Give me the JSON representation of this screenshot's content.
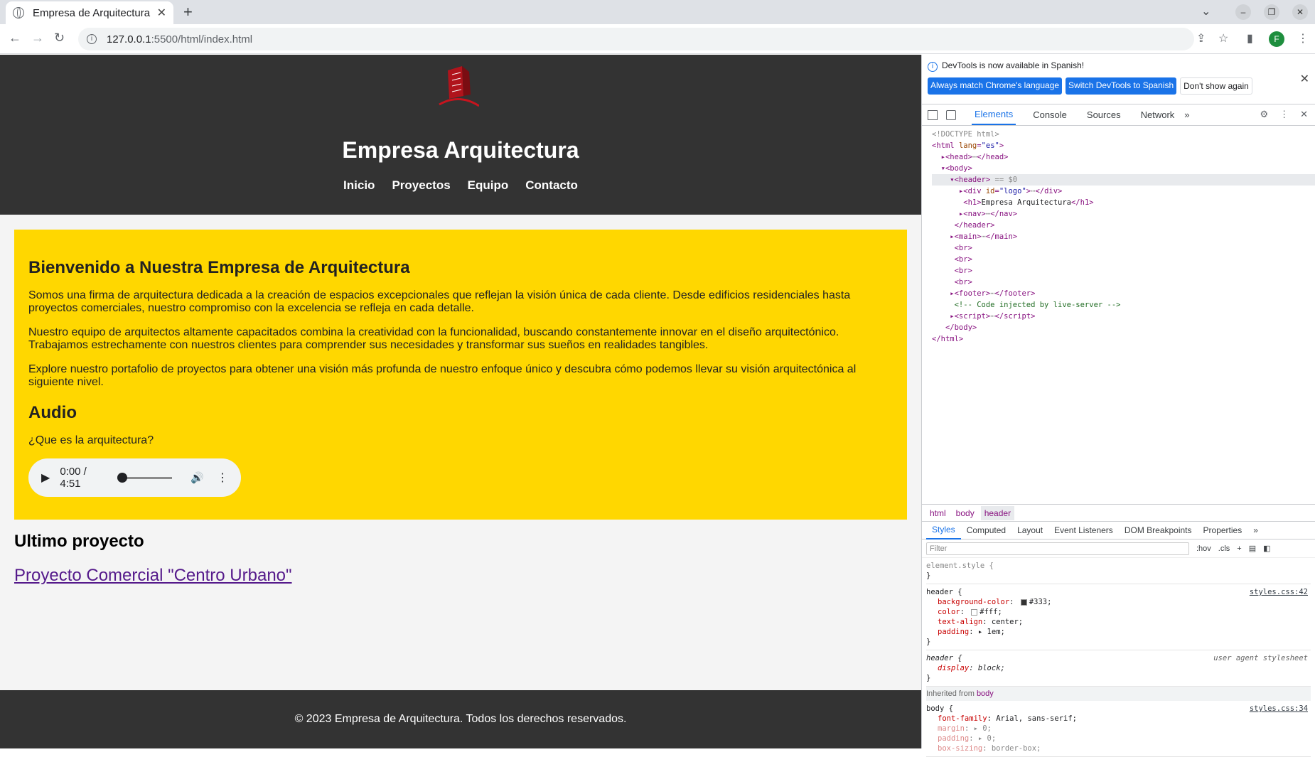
{
  "browser": {
    "tab_title": "Empresa de Arquitectura",
    "tab_close": "✕",
    "new_tab": "+",
    "url_host": "127.0.0.1",
    "url_path": ":5500/html/index.html",
    "avatar_letter": "F"
  },
  "site": {
    "title": "Empresa Arquitectura",
    "nav": [
      "Inicio",
      "Proyectos",
      "Equipo",
      "Contacto"
    ],
    "intro_heading": "Bienvenido a Nuestra Empresa de Arquitectura",
    "paragraphs": [
      "Somos una firma de arquitectura dedicada a la creación de espacios excepcionales que reflejan la visión única de cada cliente. Desde edificios residenciales hasta proyectos comerciales, nuestro compromiso con la excelencia se refleja en cada detalle.",
      "Nuestro equipo de arquitectos altamente capacitados combina la creatividad con la funcionalidad, buscando constantemente innovar en el diseño arquitectónico. Trabajamos estrechamente con nuestros clientes para comprender sus necesidades y transformar sus sueños en realidades tangibles.",
      "Explore nuestro portafolio de proyectos para obtener una visión más profunda de nuestro enfoque único y descubra cómo podemos llevar su visión arquitectónica al siguiente nivel."
    ],
    "audio_heading": "Audio",
    "audio_question": "¿Que es la arquitectura?",
    "audio_time": "0:00 / 4:51",
    "latest_heading": "Ultimo proyecto",
    "project_link": "Proyecto Comercial \"Centro Urbano\"",
    "footer": "© 2023 Empresa de Arquitectura. Todos los derechos reservados."
  },
  "devtools": {
    "info_text": "DevTools is now available in Spanish!",
    "btn_match": "Always match Chrome's language",
    "btn_switch": "Switch DevTools to Spanish",
    "btn_dont": "Don't show again",
    "tabs": [
      "Elements",
      "Console",
      "Sources",
      "Network"
    ],
    "breadcrumbs": [
      "html",
      "body",
      "header"
    ],
    "sub_tabs": [
      "Styles",
      "Computed",
      "Layout",
      "Event Listeners",
      "DOM Breakpoints",
      "Properties"
    ],
    "filter_placeholder": "Filter",
    "hov": ":hov",
    "cls": ".cls",
    "inherited_label": "Inherited from",
    "inherited_from": "body",
    "header_src": "styles.css:42",
    "ua_label": "user agent stylesheet",
    "body_src": "styles.css:34"
  },
  "colors": {
    "header_bg": "#333333",
    "intro_bg": "#ffd700",
    "accent": "#1a73e8",
    "link": "#551a8b"
  }
}
